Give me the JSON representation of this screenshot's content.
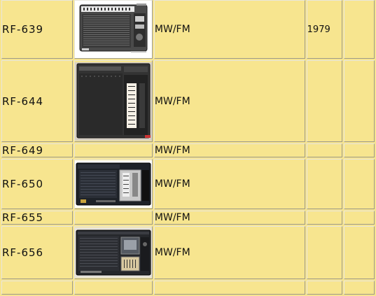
{
  "table": {
    "rows": [
      {
        "model": "RF-639",
        "band": "MW/FM",
        "year": "1979",
        "photo": "radio-photo"
      },
      {
        "model": "RF-644",
        "band": "MW/FM",
        "year": "",
        "photo": "radio-photo"
      },
      {
        "model": "RF-649",
        "band": "MW/FM",
        "year": "",
        "photo": ""
      },
      {
        "model": "RF-650",
        "band": "MW/FM",
        "year": "",
        "photo": "radio-photo"
      },
      {
        "model": "RF-655",
        "band": "MW/FM",
        "year": "",
        "photo": ""
      },
      {
        "model": "RF-656",
        "band": "MW/FM",
        "year": "",
        "photo": "radio-photo"
      }
    ]
  },
  "colors": {
    "page_bg": "#f6e490",
    "cell_bg": "#f7e58f"
  }
}
